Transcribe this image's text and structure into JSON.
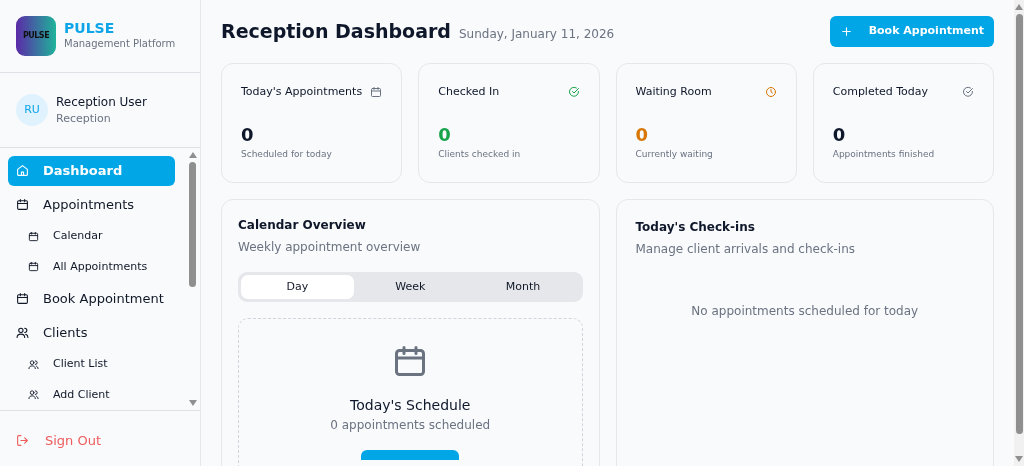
{
  "brand": {
    "logo_text": "PULSE",
    "name": "PULSE",
    "tagline": "Management Platform"
  },
  "user": {
    "initials": "RU",
    "name": "Reception User",
    "role": "Reception"
  },
  "nav": [
    {
      "label": "Dashboard",
      "kind": "home",
      "selected": true
    },
    {
      "label": "Appointments",
      "kind": "calendar",
      "selected": false,
      "children": [
        {
          "label": "Calendar",
          "kind": "calendar",
          "selected": false
        },
        {
          "label": "All Appointments",
          "kind": "calendar",
          "selected": false
        }
      ]
    },
    {
      "label": "Book Appointment",
      "kind": "calendar",
      "selected": false
    },
    {
      "label": "Clients",
      "kind": "users",
      "selected": false,
      "children": [
        {
          "label": "Client List",
          "kind": "users",
          "selected": false
        },
        {
          "label": "Add Client",
          "kind": "users",
          "selected": false
        }
      ]
    }
  ],
  "sign_out": "Sign Out",
  "header": {
    "title": "Reception Dashboard",
    "date": "Sunday, January 11, 2026",
    "button": "Book Appointment"
  },
  "stats": [
    {
      "title": "Today's Appointments",
      "kind": "calendar",
      "value": "0",
      "caption": "Scheduled for today",
      "color": "#0f172a"
    },
    {
      "title": "Checked In",
      "kind": "check",
      "value": "0",
      "caption": "Clients checked in",
      "color": "#16a34a"
    },
    {
      "title": "Waiting Room",
      "kind": "clock",
      "value": "0",
      "caption": "Currently waiting",
      "color": "#d97706"
    },
    {
      "title": "Completed Today",
      "kind": "check",
      "value": "0",
      "caption": "Appointments finished",
      "color": "#0f172a"
    }
  ],
  "calendar": {
    "title": "Calendar Overview",
    "subtitle": "Weekly appointment overview",
    "tabs": [
      {
        "label": "Day",
        "selected": true
      },
      {
        "label": "Week",
        "selected": false
      },
      {
        "label": "Month",
        "selected": false
      }
    ],
    "schedule_title": "Today's Schedule",
    "schedule_count": "0 appointments scheduled"
  },
  "checkins": {
    "title": "Today's Check-ins",
    "subtitle": "Manage client arrivals and check-ins",
    "empty": "No appointments scheduled for today"
  }
}
